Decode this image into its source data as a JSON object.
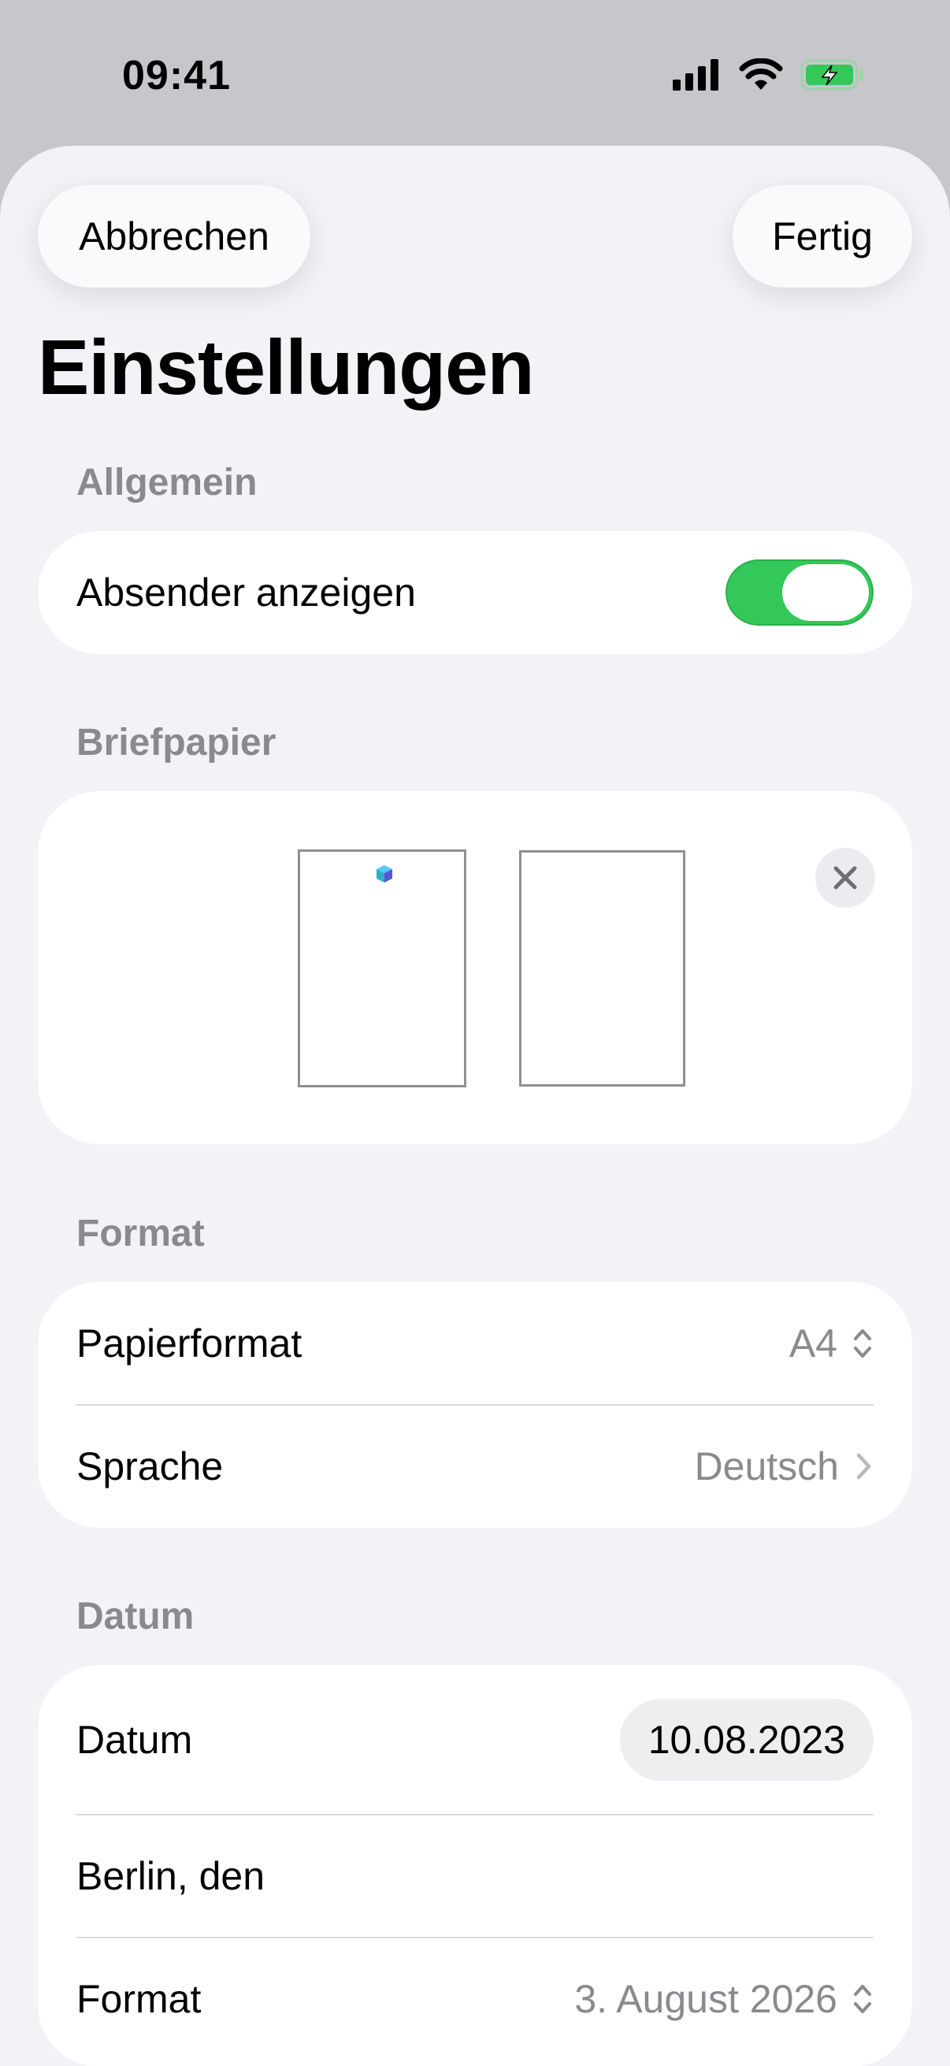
{
  "status": {
    "time": "09:41"
  },
  "nav": {
    "cancel_label": "Abbrechen",
    "done_label": "Fertig"
  },
  "page": {
    "title": "Einstellungen"
  },
  "general": {
    "header": "Allgemein",
    "show_sender_label": "Absender anzeigen",
    "show_sender_on": true
  },
  "letterhead": {
    "header": "Briefpapier"
  },
  "format": {
    "header": "Format",
    "paper_label": "Papierformat",
    "paper_value": "A4",
    "language_label": "Sprache",
    "language_value": "Deutsch"
  },
  "date": {
    "header": "Datum",
    "date_label": "Datum",
    "date_value": "10.08.2023",
    "place_text": "Berlin, den",
    "format_label": "Format",
    "format_value": "3. August 2026"
  },
  "colors": {
    "accent_green": "#34c759",
    "secondary_text": "#8a8a8e",
    "background": "#f2f2f7"
  }
}
